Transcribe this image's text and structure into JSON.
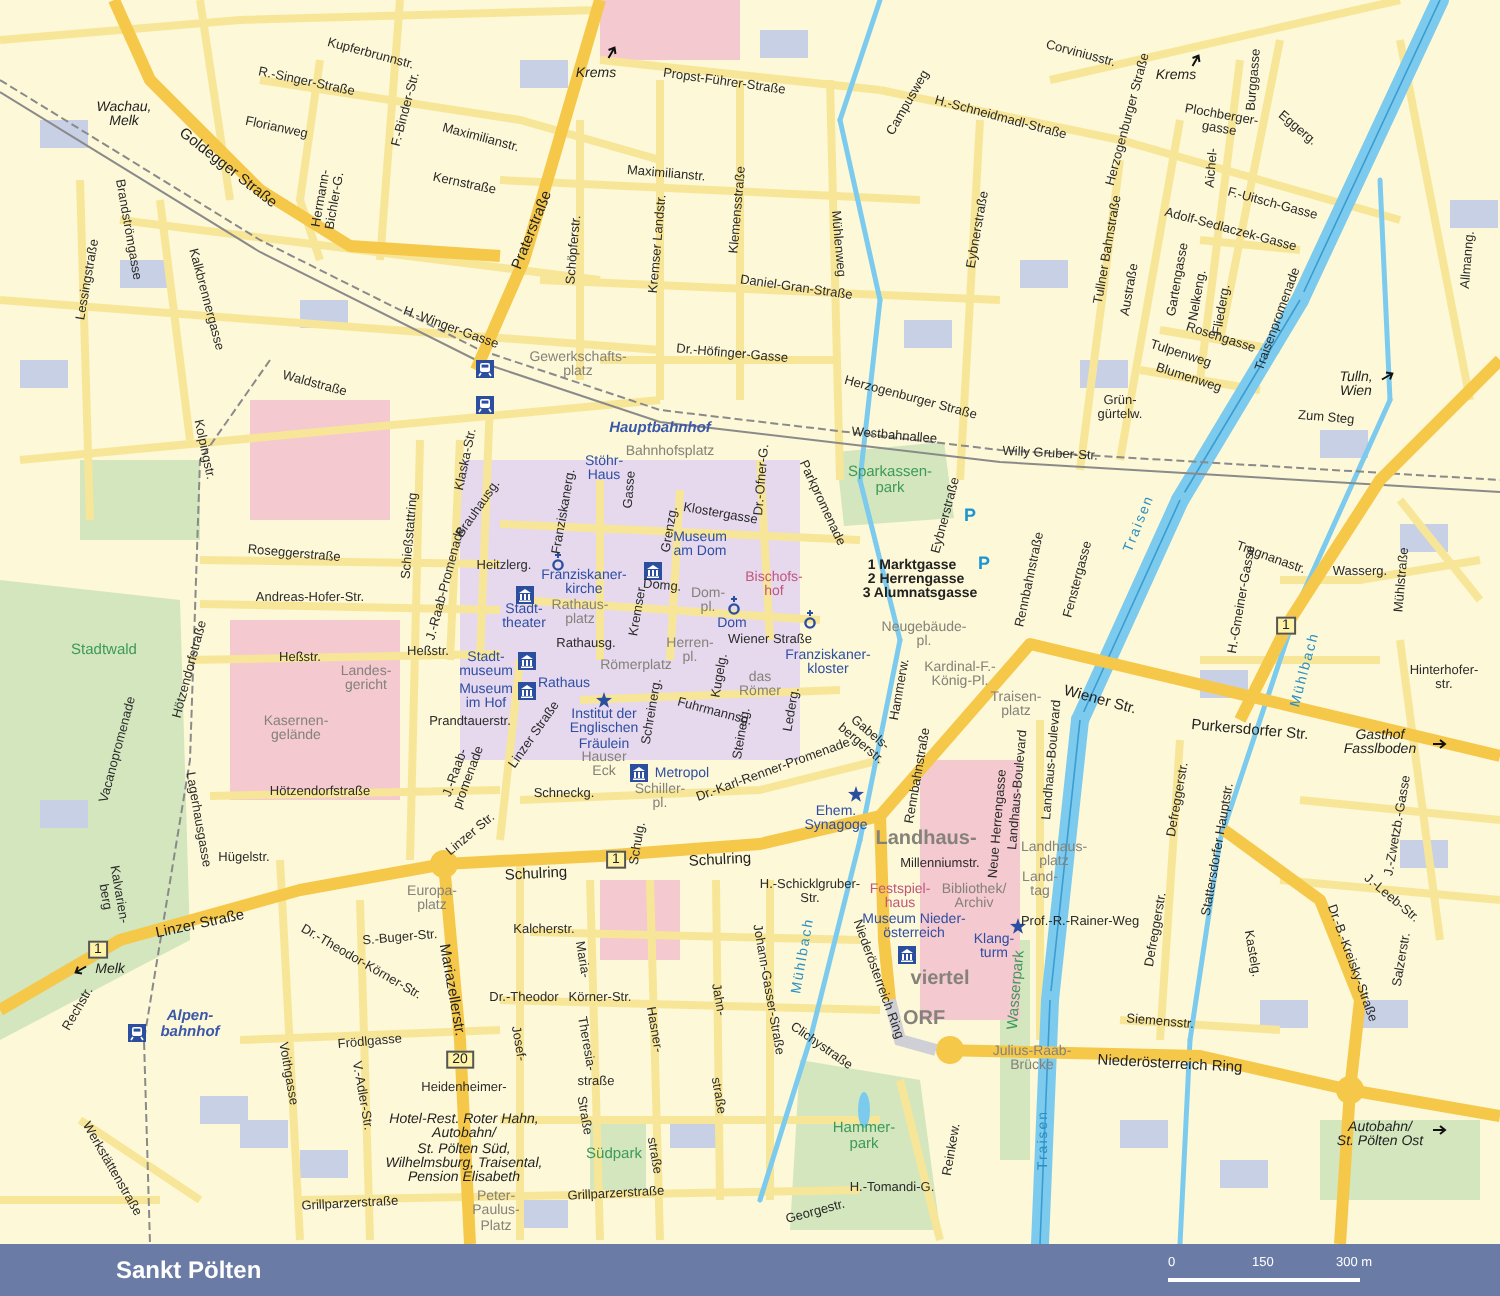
{
  "map": {
    "labels": [
      {
        "text": "Kupferbrunnstr.",
        "kind": "street"
      },
      {
        "text": "R.-Singer-Straße",
        "kind": "street"
      },
      {
        "text": "F.-Binder-Str.",
        "kind": "street"
      },
      {
        "text": "Florianweg",
        "kind": "street"
      },
      {
        "text": "Wachau,\nMelk",
        "kind": "direction"
      },
      {
        "text": "Goldegger Straße",
        "kind": "major"
      },
      {
        "text": "Hermann-\nBichler-G.",
        "kind": "street"
      },
      {
        "text": "Maximilianstr.",
        "kind": "street"
      },
      {
        "text": "Kernstraße",
        "kind": "street"
      },
      {
        "text": "Brandströmgasse",
        "kind": "street"
      },
      {
        "text": "Lessingstraße",
        "kind": "street"
      },
      {
        "text": "Kalkbrennergasse",
        "kind": "street"
      },
      {
        "text": "Praterstraße",
        "kind": "major"
      },
      {
        "text": "H.-Winger-Gasse",
        "kind": "street"
      },
      {
        "text": "Waldstraße",
        "kind": "street"
      },
      {
        "text": "Kolpingstr.",
        "kind": "street"
      },
      {
        "text": "Roseggerstraße",
        "kind": "street"
      },
      {
        "text": "Andreas-Hofer-Str.",
        "kind": "street"
      },
      {
        "text": "Schießstattring",
        "kind": "street"
      },
      {
        "text": "Klaska-Str.",
        "kind": "street"
      },
      {
        "text": "J.-Raab-Promenade",
        "kind": "street"
      },
      {
        "text": "Krems",
        "kind": "direction"
      },
      {
        "text": "Propst-Führer-Straße",
        "kind": "street"
      },
      {
        "text": "Schöpferstr.",
        "kind": "street"
      },
      {
        "text": "Kremser Landstr.",
        "kind": "street"
      },
      {
        "text": "Klemensstraße",
        "kind": "street"
      },
      {
        "text": "Maximilianstr.",
        "kind": "street"
      },
      {
        "text": "Mühlenweg",
        "kind": "street"
      },
      {
        "text": "Campusweg",
        "kind": "street"
      },
      {
        "text": "H.-Schneidmadl-Straße",
        "kind": "street"
      },
      {
        "text": "Eybnerstraße",
        "kind": "street"
      },
      {
        "text": "Daniel-Gran-Straße",
        "kind": "street"
      },
      {
        "text": "Dr.-Höfinger-Gasse",
        "kind": "street"
      },
      {
        "text": "Gewerkschafts-\nplatz",
        "kind": "place"
      },
      {
        "text": "Herzogenburger Straße",
        "kind": "street"
      },
      {
        "text": "Hauptbahnhof",
        "kind": "station"
      },
      {
        "text": "Bahnhofsplatz",
        "kind": "place"
      },
      {
        "text": "Westbahnallee",
        "kind": "street"
      },
      {
        "text": "Willy Gruber-Str.",
        "kind": "street"
      },
      {
        "text": "Stöhr-\nHaus",
        "kind": "poi"
      },
      {
        "text": "Dr.-Ofner-G.",
        "kind": "street"
      },
      {
        "text": "Parkpromenade",
        "kind": "street"
      },
      {
        "text": "Sparkassen-\npark",
        "kind": "park"
      },
      {
        "text": "Eybnerstraße",
        "kind": "street"
      },
      {
        "text": "Klostergasse",
        "kind": "street"
      },
      {
        "text": "Brauhausg.",
        "kind": "street"
      },
      {
        "text": "Franziskanerg.",
        "kind": "street"
      },
      {
        "text": "Gasse",
        "kind": "street"
      },
      {
        "text": "Grenzg.",
        "kind": "street"
      },
      {
        "text": "Museum\nam Dom",
        "kind": "poi"
      },
      {
        "text": "Heitzlerg.",
        "kind": "street"
      },
      {
        "text": "Franziskaner-\nkirche",
        "kind": "poi"
      },
      {
        "text": "Bischofs-\nhof",
        "kind": "landmark"
      },
      {
        "text": "Domg.",
        "kind": "street"
      },
      {
        "text": "Dom-\npl.",
        "kind": "place"
      },
      {
        "text": "Kremser",
        "kind": "street"
      },
      {
        "text": "P",
        "kind": "parking"
      },
      {
        "text": "1 Marktgasse",
        "kind": "legend"
      },
      {
        "text": "P",
        "kind": "parking"
      },
      {
        "text": "2 Herrengasse",
        "kind": "legend"
      },
      {
        "text": "3 Alumnatsgasse",
        "kind": "legend"
      },
      {
        "text": "Corviniusstr.",
        "kind": "street"
      },
      {
        "text": "Krems",
        "kind": "direction"
      },
      {
        "text": "Herzogenburger Straße",
        "kind": "street"
      },
      {
        "text": "Burggasse",
        "kind": "street"
      },
      {
        "text": "Plochberger-\ngasse",
        "kind": "street"
      },
      {
        "text": "Eggerg.",
        "kind": "street"
      },
      {
        "text": "Aichel-",
        "kind": "street"
      },
      {
        "text": "F.-Uitsch-Gasse",
        "kind": "street"
      },
      {
        "text": "Adolf-Sedlaczek-Gasse",
        "kind": "street"
      },
      {
        "text": "Tullner Bahnstraße",
        "kind": "street"
      },
      {
        "text": "Austraße",
        "kind": "street"
      },
      {
        "text": "Gartengasse",
        "kind": "street"
      },
      {
        "text": "Nelkeng.",
        "kind": "street"
      },
      {
        "text": "Fliederg.",
        "kind": "street"
      },
      {
        "text": "Traisenpromenade",
        "kind": "street"
      },
      {
        "text": "Rosengasse",
        "kind": "street"
      },
      {
        "text": "Tulpenweg",
        "kind": "street"
      },
      {
        "text": "Blumenweg",
        "kind": "street"
      },
      {
        "text": "Grün-\ngürtelw.",
        "kind": "street"
      },
      {
        "text": "Allmanng.",
        "kind": "street"
      },
      {
        "text": "Tulln,\nWien",
        "kind": "direction"
      },
      {
        "text": "Zum Steg",
        "kind": "street"
      },
      {
        "text": "Traisen",
        "kind": "water"
      },
      {
        "text": "Rennbahnstraße",
        "kind": "street"
      },
      {
        "text": "Fenstergasse",
        "kind": "street"
      },
      {
        "text": "H.-Gmeiner-Gasse",
        "kind": "street"
      },
      {
        "text": "Tragnanastr.",
        "kind": "street"
      },
      {
        "text": "Wasserg.",
        "kind": "street"
      },
      {
        "text": "Mühlstraße",
        "kind": "street"
      },
      {
        "text": "Dom",
        "kind": "poi"
      },
      {
        "text": "Neugebäude-\npl.",
        "kind": "place"
      },
      {
        "text": "1",
        "kind": "shield"
      },
      {
        "text": "Wiener Straße",
        "kind": "street"
      },
      {
        "text": "Franziskaner-\nkloster",
        "kind": "poi"
      },
      {
        "text": "Herren-\npl.",
        "kind": "place"
      },
      {
        "text": "Kugelg.",
        "kind": "street"
      },
      {
        "text": "das\nRömer",
        "kind": "place"
      },
      {
        "text": "Kardinal-F.-\nKönig-Pl.",
        "kind": "place"
      },
      {
        "text": "Hammerw.",
        "kind": "street"
      },
      {
        "text": "Mühlbach",
        "kind": "water"
      },
      {
        "text": "Hinterhofer-\nstr.",
        "kind": "street"
      },
      {
        "text": "Wiener Str.",
        "kind": "major"
      },
      {
        "text": "Traisen-\nplatz",
        "kind": "place"
      },
      {
        "text": "Purkersdorfer Str.",
        "kind": "major"
      },
      {
        "text": "Gasthof\nFasslboden",
        "kind": "direction"
      },
      {
        "text": "Stadtwald",
        "kind": "park"
      },
      {
        "text": "Hötzendorfstraße",
        "kind": "street"
      },
      {
        "text": "Heßstr.",
        "kind": "street"
      },
      {
        "text": "Landes-\ngericht",
        "kind": "place"
      },
      {
        "text": "Heßstr.",
        "kind": "street"
      },
      {
        "text": "Stadt-\ntheater",
        "kind": "poi"
      },
      {
        "text": "Rathaus-\nplatz",
        "kind": "place"
      },
      {
        "text": "Rathausg.",
        "kind": "street"
      },
      {
        "text": "Stadt-\nmuseum",
        "kind": "poi"
      },
      {
        "text": "Römerplatz",
        "kind": "place"
      },
      {
        "text": "Rathaus",
        "kind": "poi"
      },
      {
        "text": "Museum\nim Hof",
        "kind": "poi"
      },
      {
        "text": "Kasernen-\ngelände",
        "kind": "place"
      },
      {
        "text": "Prandtauerstr.",
        "kind": "street"
      },
      {
        "text": "Linzer Straße",
        "kind": "street"
      },
      {
        "text": "Institut der\nEnglischen\nFräulein",
        "kind": "poi"
      },
      {
        "text": "Schreinerg.",
        "kind": "street"
      },
      {
        "text": "Fuhrmannsg.",
        "kind": "street"
      },
      {
        "text": "Lederg.",
        "kind": "street"
      },
      {
        "text": "Gabels-\nbergerstr.",
        "kind": "street"
      },
      {
        "text": "Steinerg.",
        "kind": "street"
      },
      {
        "text": "J.-Raab-\npromenade",
        "kind": "street"
      },
      {
        "text": "Hauser\nEck",
        "kind": "place"
      },
      {
        "text": "Metropol",
        "kind": "poi"
      },
      {
        "text": "Landhaus-Boulevard",
        "kind": "street"
      },
      {
        "text": "Landhaus-Boulevard",
        "kind": "street"
      },
      {
        "text": "Defreggerstr.",
        "kind": "street"
      },
      {
        "text": "Hötzendorfstraße",
        "kind": "street"
      },
      {
        "text": "Vacanopromenade",
        "kind": "street"
      },
      {
        "text": "Schneckg.",
        "kind": "street"
      },
      {
        "text": "Schiller-\npl.",
        "kind": "place"
      },
      {
        "text": "Dr.-Karl-Renner-Promenade",
        "kind": "street"
      },
      {
        "text": "Schulg.",
        "kind": "street"
      },
      {
        "text": "Ehem.\nSynagoge",
        "kind": "poi"
      },
      {
        "text": "Rennbahnstraße",
        "kind": "street"
      },
      {
        "text": "J.-Zwetzb.-Gasse",
        "kind": "street"
      },
      {
        "text": "Lagerhausgasse",
        "kind": "street"
      },
      {
        "text": "Hügelstr.",
        "kind": "street"
      },
      {
        "text": "Europa-\nplatz",
        "kind": "place"
      },
      {
        "text": "Linzer Str.",
        "kind": "street"
      },
      {
        "text": "Schulring",
        "kind": "major"
      },
      {
        "text": "1",
        "kind": "shield"
      },
      {
        "text": "Schulring",
        "kind": "major"
      },
      {
        "text": "Landhaus-",
        "kind": "district"
      },
      {
        "text": "Neue Herrengasse",
        "kind": "street"
      },
      {
        "text": "Millenniumstr.",
        "kind": "street"
      },
      {
        "text": "Landhaus-\nplatz",
        "kind": "place"
      },
      {
        "text": "Stattersdorfer Hauptstr.",
        "kind": "street"
      },
      {
        "text": "Kalvarien-\nberg",
        "kind": "street"
      },
      {
        "text": "H.-Schicklgruber-\nStr.",
        "kind": "street"
      },
      {
        "text": "Festspiel-\nhaus",
        "kind": "landmark"
      },
      {
        "text": "Bibliothek/\nArchiv",
        "kind": "place"
      },
      {
        "text": "Land-\ntag",
        "kind": "place"
      },
      {
        "text": "J.-Leeb-Str.",
        "kind": "street"
      },
      {
        "text": "Linzer Straße",
        "kind": "major"
      },
      {
        "text": "1",
        "kind": "shield"
      },
      {
        "text": "S.-Buger-Str.",
        "kind": "street"
      },
      {
        "text": "Prof.-R.-Rainer-Weg",
        "kind": "street"
      },
      {
        "text": "Defreggerstr.",
        "kind": "street"
      },
      {
        "text": "Kalcherstr.",
        "kind": "street"
      },
      {
        "text": "Museum Nieder-\nösterreich",
        "kind": "poi"
      },
      {
        "text": "Klang-\nturm",
        "kind": "poi"
      },
      {
        "text": "Kastelg.",
        "kind": "street"
      },
      {
        "text": "Dr.-B.-Kreisky-Straße",
        "kind": "street"
      },
      {
        "text": "Salzerstr.",
        "kind": "street"
      },
      {
        "text": "Dr.-Theodor-Körner-Str.",
        "kind": "street"
      },
      {
        "text": "Melk",
        "kind": "direction"
      },
      {
        "text": "Mühlbach",
        "kind": "water"
      },
      {
        "text": "Johann-Gasser-Straße",
        "kind": "street"
      },
      {
        "text": "viertel",
        "kind": "district"
      },
      {
        "text": "Niederösterreich Ring",
        "kind": "street"
      },
      {
        "text": "Mariazellerstr.",
        "kind": "major"
      },
      {
        "text": "Maria-",
        "kind": "street"
      },
      {
        "text": "Dr.-Theodor",
        "kind": "street"
      },
      {
        "text": "Körner-Str.",
        "kind": "street"
      },
      {
        "text": "Jahn-",
        "kind": "street"
      },
      {
        "text": "Rechstr.",
        "kind": "street"
      },
      {
        "text": "Wasserpark",
        "kind": "park"
      },
      {
        "text": "ORF",
        "kind": "district"
      },
      {
        "text": "Alpen-\nbahnhof",
        "kind": "station"
      },
      {
        "text": "Siemensstr.",
        "kind": "street"
      },
      {
        "text": "Hasner-",
        "kind": "street"
      },
      {
        "text": "Frödlgasse",
        "kind": "street"
      },
      {
        "text": "20",
        "kind": "shield"
      },
      {
        "text": "Josef-",
        "kind": "street"
      },
      {
        "text": "Theresia-",
        "kind": "street"
      },
      {
        "text": "Clichystraße",
        "kind": "street"
      },
      {
        "text": "Julius-Raab-\nBrücke",
        "kind": "place"
      },
      {
        "text": "Niederösterreich Ring",
        "kind": "major"
      },
      {
        "text": "Voithgasse",
        "kind": "street"
      },
      {
        "text": "straße",
        "kind": "street"
      },
      {
        "text": "Heidenheimer-",
        "kind": "street"
      },
      {
        "text": "V.-Adler-Str.",
        "kind": "street"
      },
      {
        "text": "straße",
        "kind": "street"
      },
      {
        "text": "Straße",
        "kind": "street"
      },
      {
        "text": "Hammer-\npark",
        "kind": "park"
      },
      {
        "text": "Autobahn/\nSt. Pölten Ost",
        "kind": "direction"
      },
      {
        "text": "Hotel-Rest. Roter Hahn,\nAutobahn/\nSt. Pölten Süd,\nWilhelmsburg, Traisental,\nPension Elisabeth",
        "kind": "direction"
      },
      {
        "text": "Traisen",
        "kind": "water"
      },
      {
        "text": "Reinkew.",
        "kind": "street"
      },
      {
        "text": "Südpark",
        "kind": "park"
      },
      {
        "text": "straße",
        "kind": "street"
      },
      {
        "text": "Werkstättenstraße",
        "kind": "street"
      },
      {
        "text": "H.-Tomandi-G.",
        "kind": "street"
      },
      {
        "text": "Grillparzerstraße",
        "kind": "street"
      },
      {
        "text": "Grillparzerstraße",
        "kind": "street"
      },
      {
        "text": "Peter-\nPaulus-\nPlatz",
        "kind": "place"
      },
      {
        "text": "Georgestr.",
        "kind": "street"
      }
    ]
  },
  "footer": {
    "title": "Sankt Pölten",
    "scale_labels": [
      "0",
      "150",
      "300 m"
    ]
  }
}
